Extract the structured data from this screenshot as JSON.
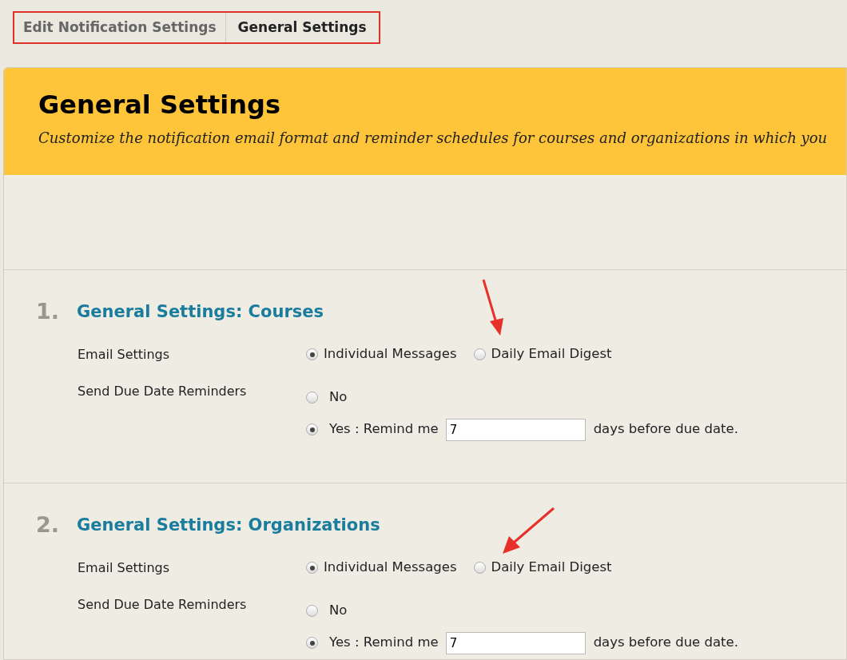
{
  "breadcrumbs": [
    {
      "label": "Edit Notification Settings",
      "selected": false
    },
    {
      "label": "General Settings",
      "selected": true
    }
  ],
  "page_header": {
    "title": "General Settings",
    "description": "Customize the notification email format and reminder schedules for courses and organizations in which you"
  },
  "sections": [
    {
      "number": "1.",
      "title": "General Settings: Courses",
      "email_settings": {
        "label": "Email Settings",
        "options": [
          {
            "label": "Individual Messages",
            "selected": true
          },
          {
            "label": "Daily Email Digest",
            "selected": false
          }
        ]
      },
      "reminders": {
        "label": "Send Due Date Reminders",
        "options": [
          {
            "label": "No",
            "selected": false
          },
          {
            "label": "Yes : Remind me",
            "selected": true
          }
        ],
        "days_value": "7",
        "suffix": "days before due date."
      }
    },
    {
      "number": "2.",
      "title": "General Settings: Organizations",
      "email_settings": {
        "label": "Email Settings",
        "options": [
          {
            "label": "Individual Messages",
            "selected": true
          },
          {
            "label": "Daily Email Digest",
            "selected": false
          }
        ]
      },
      "reminders": {
        "label": "Send Due Date Reminders",
        "options": [
          {
            "label": "No",
            "selected": false
          },
          {
            "label": "Yes : Remind me",
            "selected": true
          }
        ],
        "days_value": "7",
        "suffix": "days before due date."
      }
    }
  ]
}
